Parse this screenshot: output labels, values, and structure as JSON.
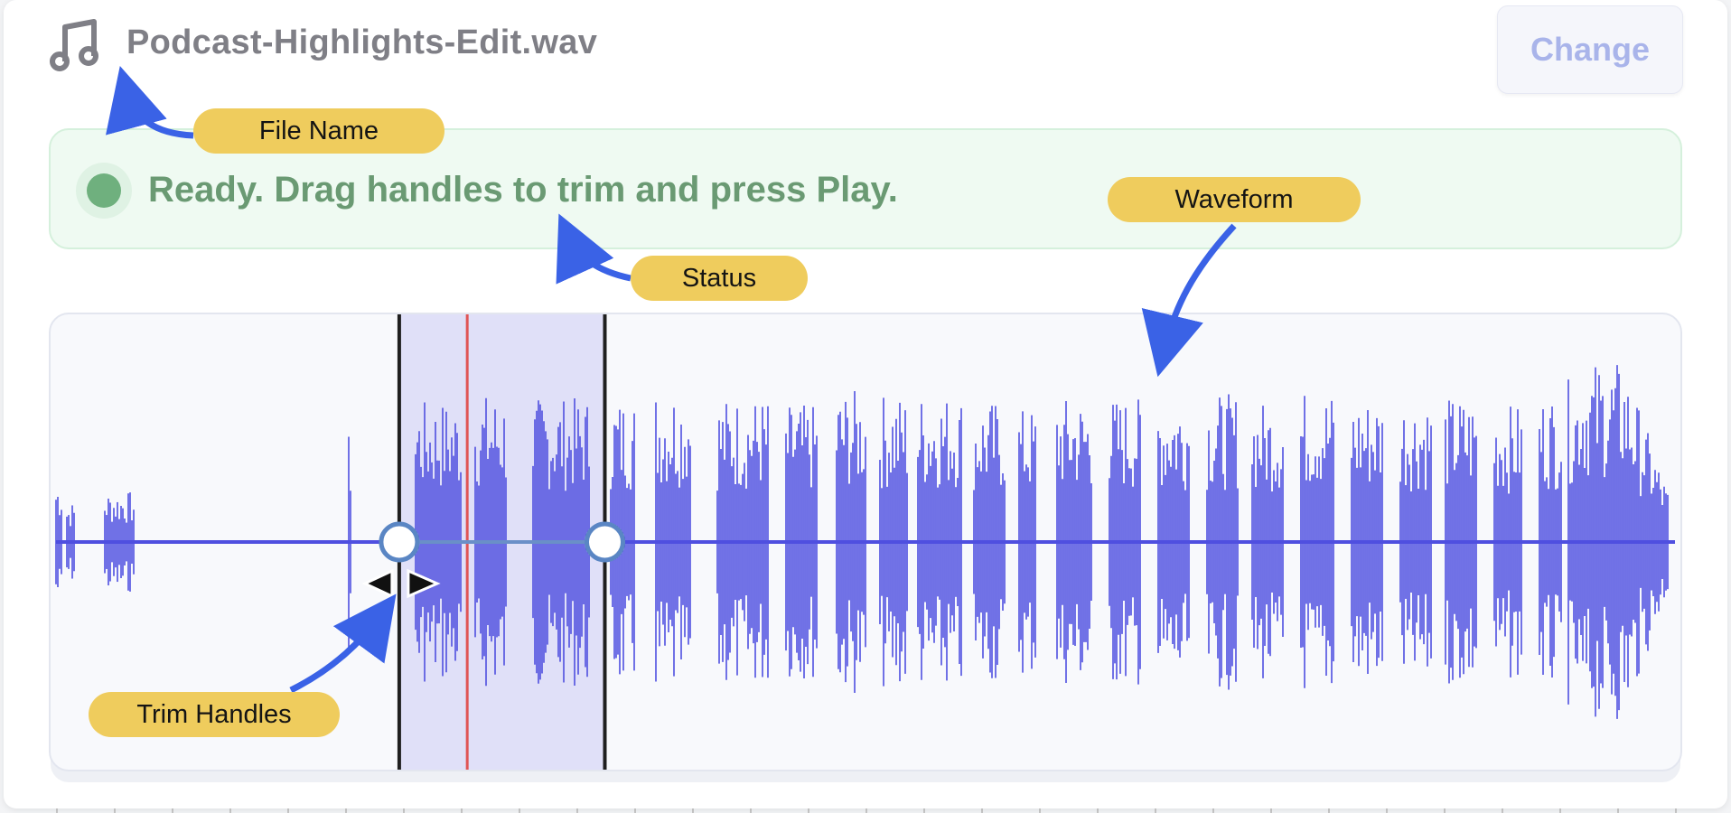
{
  "file": {
    "name": "Podcast-Highlights-Edit.wav",
    "icon": "music-note-icon"
  },
  "header": {
    "change_label": "Change"
  },
  "status": {
    "text": "Ready. Drag handles to trim and press Play.",
    "color": "#6fb07e"
  },
  "waveform": {
    "color": "#4f4fe0",
    "selection_color": "#dcdcf7",
    "playhead_color": "#e05555",
    "trim": {
      "start": 0.212,
      "end": 0.339
    },
    "playhead": 0.254
  },
  "annotations": {
    "file_name": "File Name",
    "status": "Status",
    "waveform": "Waveform",
    "trim_handles": "Trim Handles"
  },
  "colors": {
    "accent": "#4f4fe0",
    "callout": "#efcc5d",
    "arrow": "#3a62e6"
  }
}
